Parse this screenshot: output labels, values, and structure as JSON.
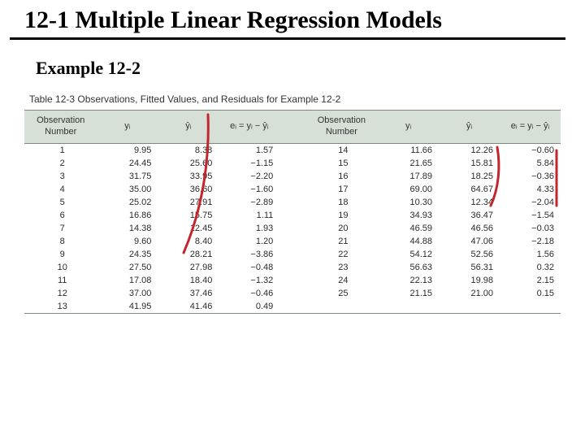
{
  "title": "12-1 Multiple Linear Regression Models",
  "example_label": "Example 12-2",
  "table": {
    "caption": "Table 12-3  Observations, Fitted Values, and Residuals for Example 12-2",
    "headers": {
      "obs": "Observation\nNumber",
      "y": "yᵢ",
      "yhat": "ŷᵢ",
      "resid": "eᵢ = yᵢ − ŷᵢ"
    },
    "left": [
      {
        "n": "1",
        "y": "9.95",
        "yhat": "8.38",
        "e": "1.57"
      },
      {
        "n": "2",
        "y": "24.45",
        "yhat": "25.60",
        "e": "−1.15"
      },
      {
        "n": "3",
        "y": "31.75",
        "yhat": "33.95",
        "e": "−2.20"
      },
      {
        "n": "4",
        "y": "35.00",
        "yhat": "36.60",
        "e": "−1.60"
      },
      {
        "n": "5",
        "y": "25.02",
        "yhat": "27.91",
        "e": "−2.89"
      },
      {
        "n": "6",
        "y": "16.86",
        "yhat": "15.75",
        "e": "1.11"
      },
      {
        "n": "7",
        "y": "14.38",
        "yhat": "12.45",
        "e": "1.93"
      },
      {
        "n": "8",
        "y": "9.60",
        "yhat": "8.40",
        "e": "1.20"
      },
      {
        "n": "9",
        "y": "24.35",
        "yhat": "28.21",
        "e": "−3.86"
      },
      {
        "n": "10",
        "y": "27.50",
        "yhat": "27.98",
        "e": "−0.48"
      },
      {
        "n": "11",
        "y": "17.08",
        "yhat": "18.40",
        "e": "−1.32"
      },
      {
        "n": "12",
        "y": "37.00",
        "yhat": "37.46",
        "e": "−0.46"
      },
      {
        "n": "13",
        "y": "41.95",
        "yhat": "41.46",
        "e": "0.49"
      }
    ],
    "right": [
      {
        "n": "14",
        "y": "11.66",
        "yhat": "12.26",
        "e": "−0.60"
      },
      {
        "n": "15",
        "y": "21.65",
        "yhat": "15.81",
        "e": "5.84"
      },
      {
        "n": "16",
        "y": "17.89",
        "yhat": "18.25",
        "e": "−0.36"
      },
      {
        "n": "17",
        "y": "69.00",
        "yhat": "64.67",
        "e": "4.33"
      },
      {
        "n": "18",
        "y": "10.30",
        "yhat": "12.34",
        "e": "−2.04"
      },
      {
        "n": "19",
        "y": "34.93",
        "yhat": "36.47",
        "e": "−1.54"
      },
      {
        "n": "20",
        "y": "46.59",
        "yhat": "46.56",
        "e": "−0.03"
      },
      {
        "n": "21",
        "y": "44.88",
        "yhat": "47.06",
        "e": "−2.18"
      },
      {
        "n": "22",
        "y": "54.12",
        "yhat": "52.56",
        "e": "1.56"
      },
      {
        "n": "23",
        "y": "56.63",
        "yhat": "56.31",
        "e": "0.32"
      },
      {
        "n": "24",
        "y": "22.13",
        "yhat": "19.98",
        "e": "2.15"
      },
      {
        "n": "25",
        "y": "21.15",
        "yhat": "21.00",
        "e": "0.15"
      },
      {
        "n": "",
        "y": "",
        "yhat": "",
        "e": ""
      }
    ]
  }
}
